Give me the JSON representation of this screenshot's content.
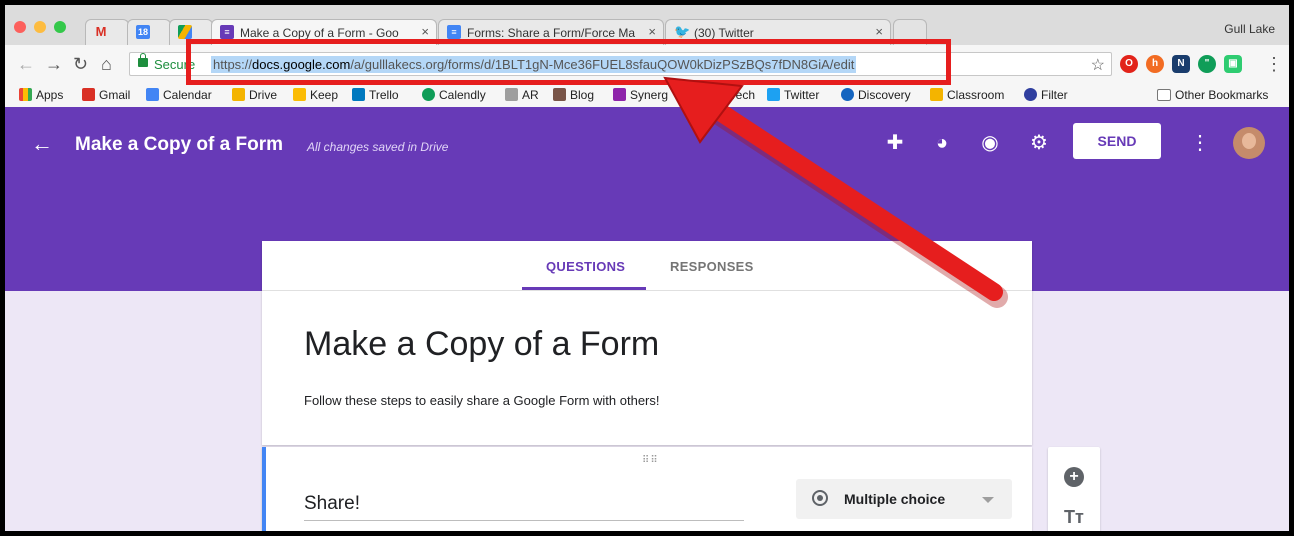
{
  "browser": {
    "tabs": [
      {
        "icon": "gmail-icon",
        "color": "#d93025",
        "label": "",
        "mark": "M"
      },
      {
        "icon": "calendar-icon",
        "color": "#4285f4",
        "label": "",
        "mark": "18"
      },
      {
        "icon": "drive-icon",
        "color": "#f4b400",
        "label": "",
        "mark": ""
      },
      {
        "icon": "forms-icon",
        "color": "#673ab7",
        "label": "Make a Copy of a Form - Goo",
        "mark": ""
      },
      {
        "icon": "docs-icon",
        "color": "#4285f4",
        "label": "Forms: Share a Form/Force Ma",
        "mark": ""
      },
      {
        "icon": "twitter-icon",
        "color": "#1da1f2",
        "label": "(30) Twitter",
        "mark": ""
      }
    ],
    "profile_name": "Gull Lake",
    "secure_label": "Secure",
    "url_scheme": "https://",
    "url_host": "docs.google.com",
    "url_path": "/a/gulllakecs.org/forms/d/1BLT1gN-Mce36FUEL8sfauQOW0kDizPSzBQs7fDN8GiA/edit",
    "bookmarks": [
      "Apps",
      "Gmail",
      "Calendar",
      "Drive",
      "Keep",
      "Trello",
      "Calendly",
      "AR",
      "Blog",
      "Synerg",
      "MiTech",
      "Twitter",
      "Discovery",
      "Classroom",
      "Filter"
    ],
    "other_bookmarks": "Other Bookmarks"
  },
  "forms": {
    "title": "Make a Copy of a Form",
    "saved_status": "All changes saved in Drive",
    "send_label": "SEND",
    "tabs": {
      "questions": "QUESTIONS",
      "responses": "RESPONSES"
    },
    "form_title": "Make a Copy of a Form",
    "form_description": "Follow these steps to easily share a Google Form with others!",
    "question_title": "Share!",
    "question_type": "Multiple choice",
    "tt_label": "Tт"
  },
  "colors": {
    "brand": "#673ab7",
    "annotation": "#e61e1e"
  }
}
